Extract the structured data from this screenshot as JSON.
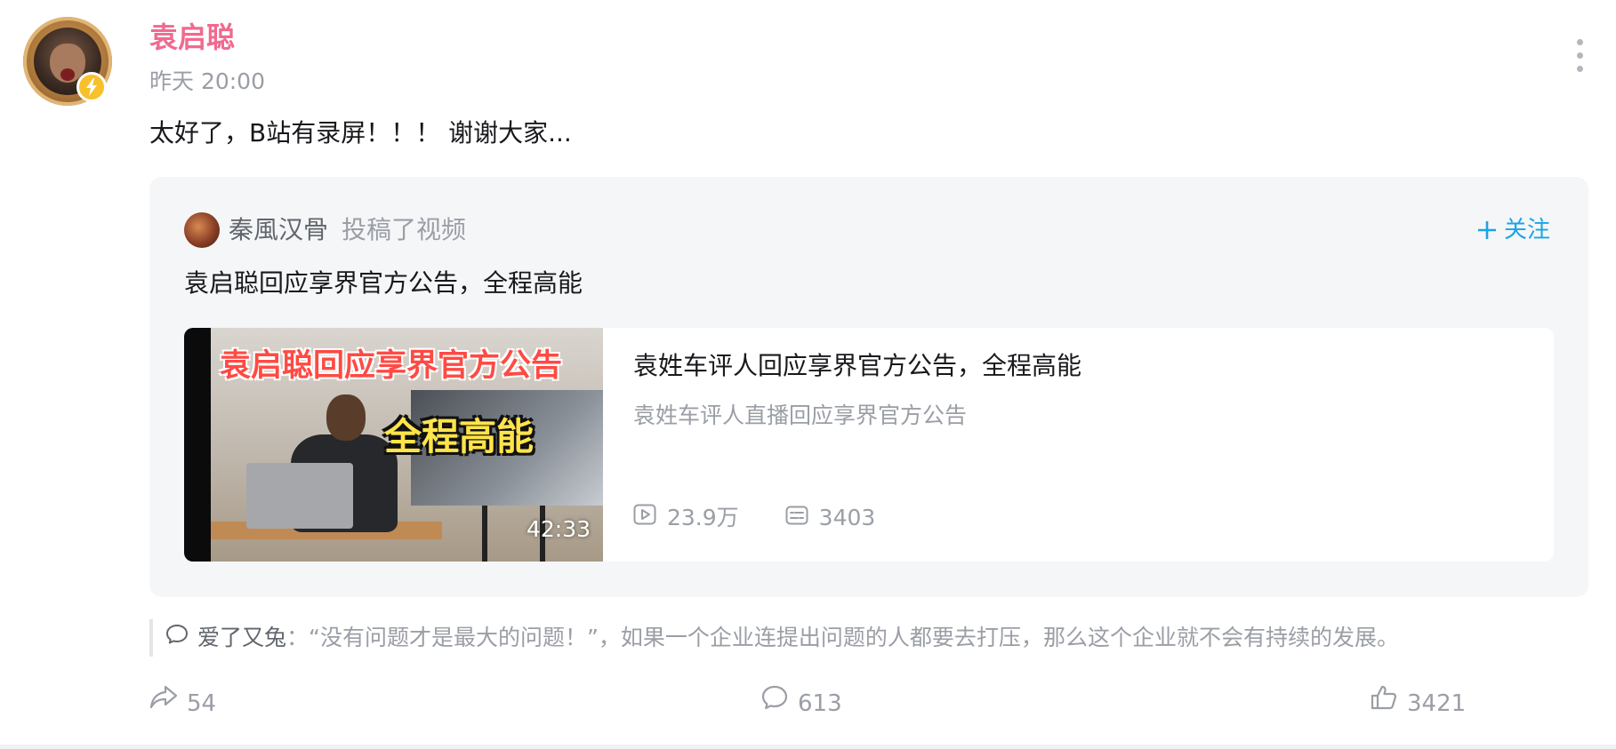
{
  "post": {
    "author": "袁启聪",
    "time": "昨天 20:00",
    "text": "太好了，B站有录屏！！！ 谢谢大家..."
  },
  "repost": {
    "original_author": "秦風汉骨",
    "action": "投稿了视频",
    "follow_label": "关注",
    "text": "袁启聪回应享界官方公告，全程高能",
    "video": {
      "thumb_title": "袁启聪回应享界官方公告",
      "thumb_subtitle": "全程高能",
      "duration": "42:33",
      "title": "袁姓车评人回应享界官方公告，全程高能",
      "description": "袁姓车评人直播回应享界官方公告",
      "views": "23.9万",
      "danmaku": "3403"
    }
  },
  "hot_comment": {
    "user": "爱了又兔",
    "separator": "：",
    "text": "“没有问题才是最大的问题！”，如果一个企业连提出问题的人都要去打压，那么这个企业就不会有持续的发展。"
  },
  "actions": {
    "share_count": "54",
    "comment_count": "613",
    "like_count": "3421"
  },
  "colors": {
    "name_pink": "#f06a8f",
    "follow_blue": "#1aa4e6",
    "muted_text": "#9a9ea5",
    "card_bg": "#f5f6f8",
    "badge_yellow": "#f7c12b"
  },
  "icons": {
    "verified": "lightning-bolt-icon",
    "more": "more-vertical-icon",
    "plus": "plus-icon",
    "play": "play-count-icon",
    "danmaku": "danmaku-icon",
    "comment": "comment-bubble-icon",
    "share": "share-icon",
    "like": "thumbs-up-icon"
  }
}
